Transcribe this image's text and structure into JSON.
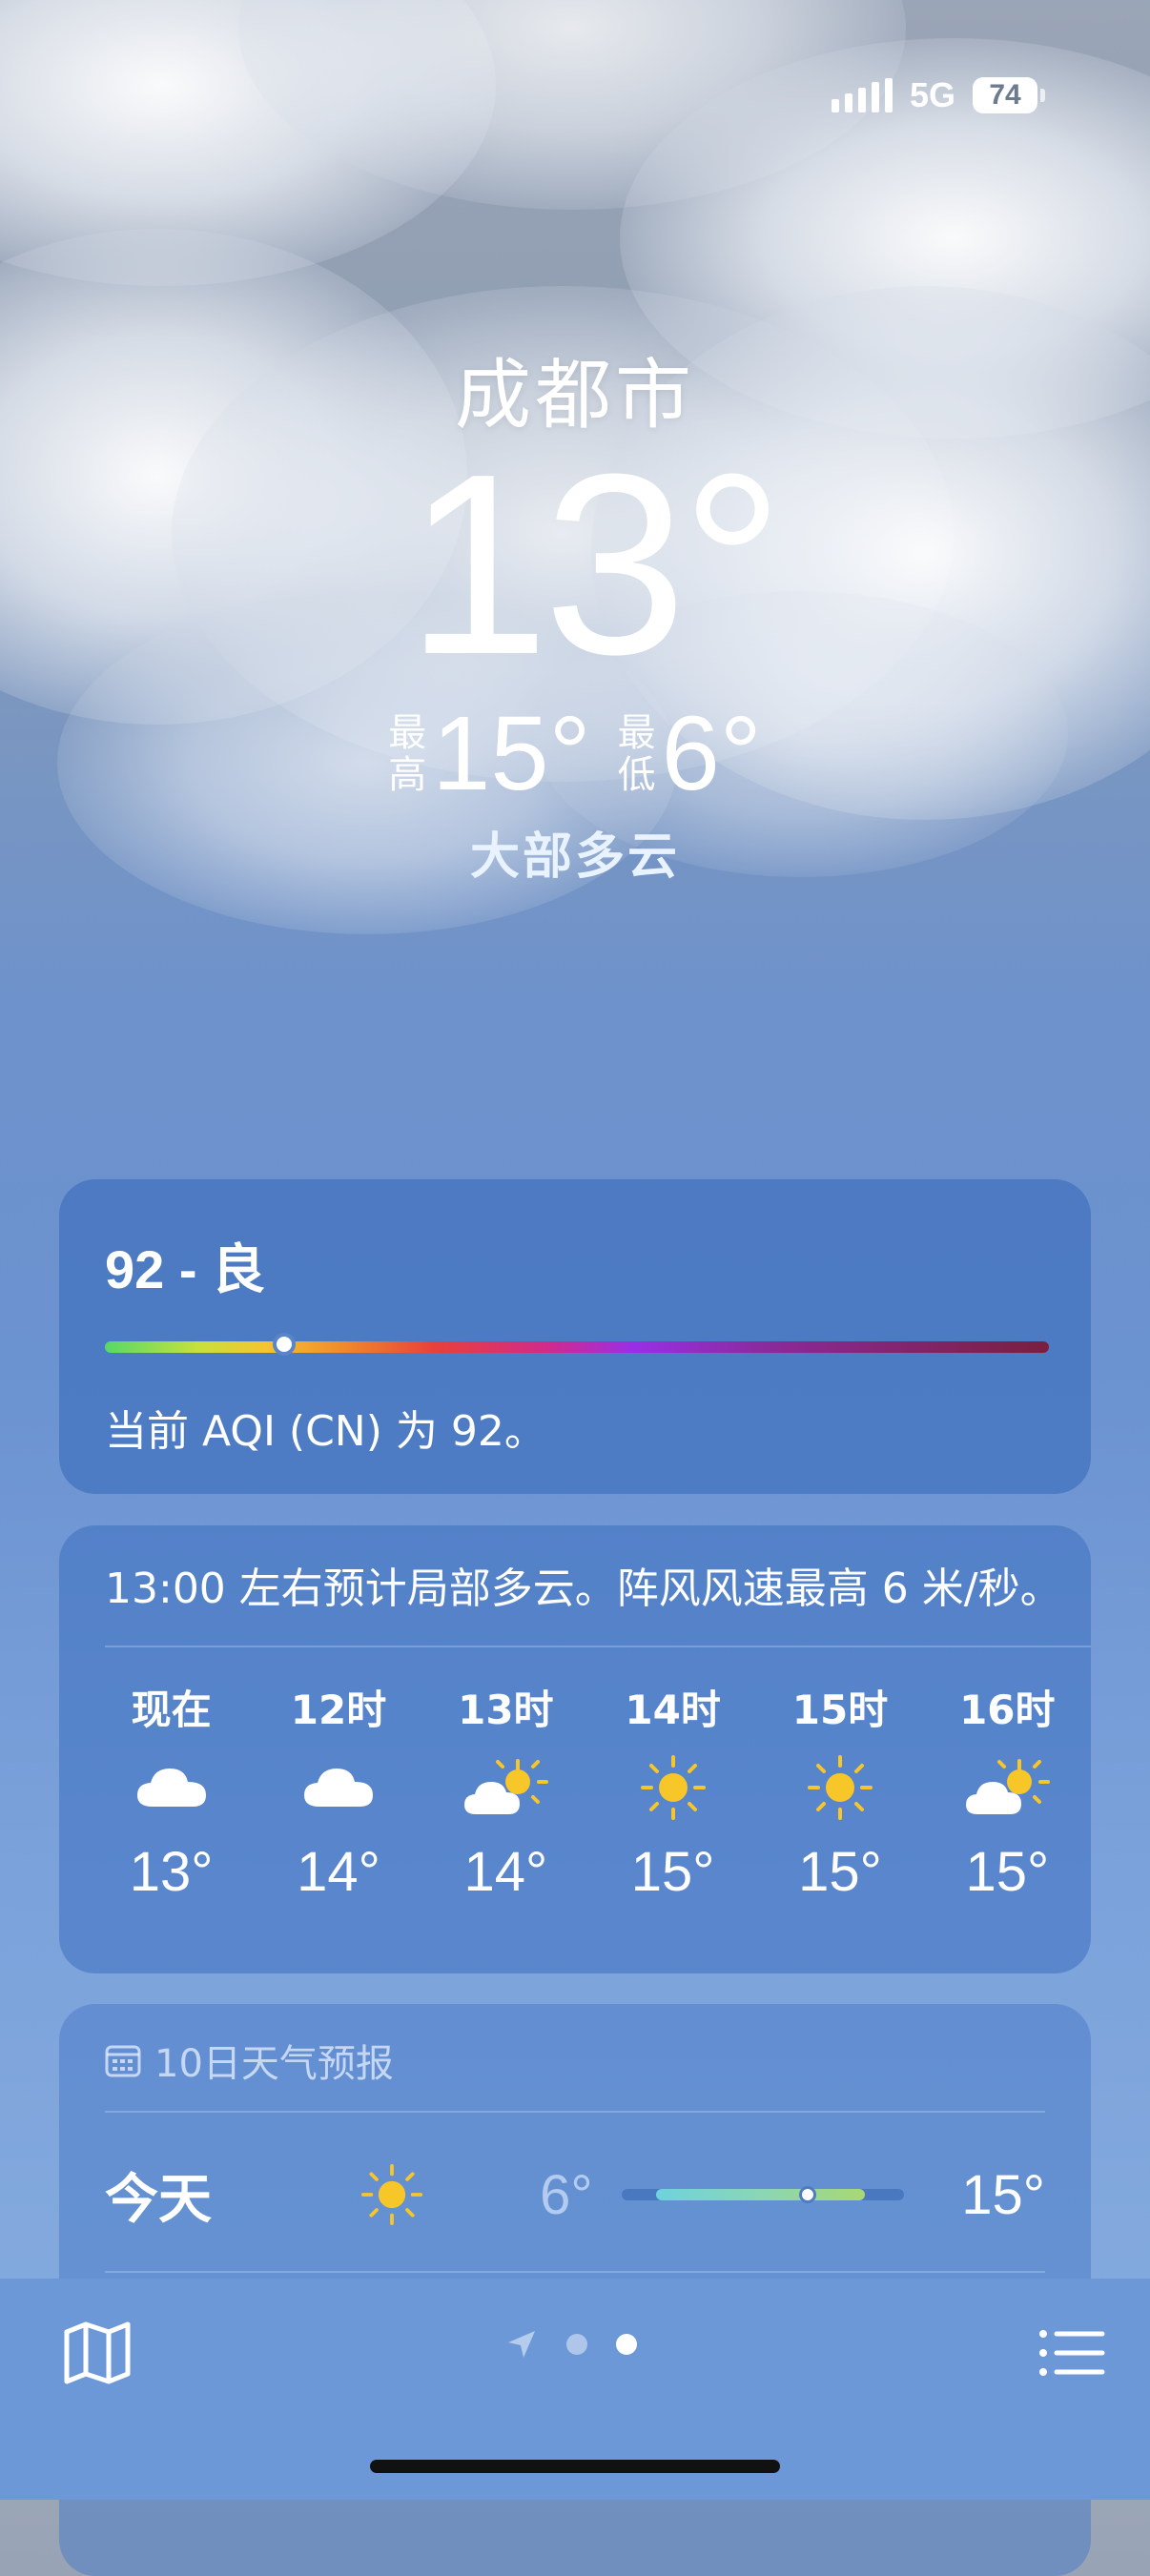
{
  "status": {
    "network": "5G",
    "battery": "74"
  },
  "location": {
    "city": "成都市",
    "current_temp": "13°",
    "high_label": "最高",
    "high": "15°",
    "low_label": "最低",
    "low": "6°",
    "condition": "大部多云"
  },
  "aqi": {
    "title": "92 - 良",
    "description": "当前 AQI (CN) 为 92。",
    "position_fraction": 0.19
  },
  "hourly": {
    "summary": "13:00 左右预计局部多云。阵风风速最高 6 米/秒。",
    "items": [
      {
        "time": "现在",
        "icon": "cloud-icon",
        "temp": "13°"
      },
      {
        "time": "12时",
        "icon": "cloud-icon",
        "temp": "14°"
      },
      {
        "time": "13时",
        "icon": "partly-sunny-icon",
        "temp": "14°"
      },
      {
        "time": "14时",
        "icon": "sun-icon",
        "temp": "15°"
      },
      {
        "time": "15时",
        "icon": "sun-icon",
        "temp": "15°"
      },
      {
        "time": "16时",
        "icon": "partly-sunny-icon",
        "temp": "15°"
      }
    ]
  },
  "daily": {
    "header": "10日天气预报",
    "days": [
      {
        "name": "今天",
        "icon": "sun-icon",
        "low": "6°",
        "high": "15°",
        "range_start": 0.12,
        "range_end": 0.85,
        "current": 0.65
      }
    ]
  },
  "colors": {
    "sun": "#f7c629",
    "bottom_bar": "#6c98d8"
  }
}
